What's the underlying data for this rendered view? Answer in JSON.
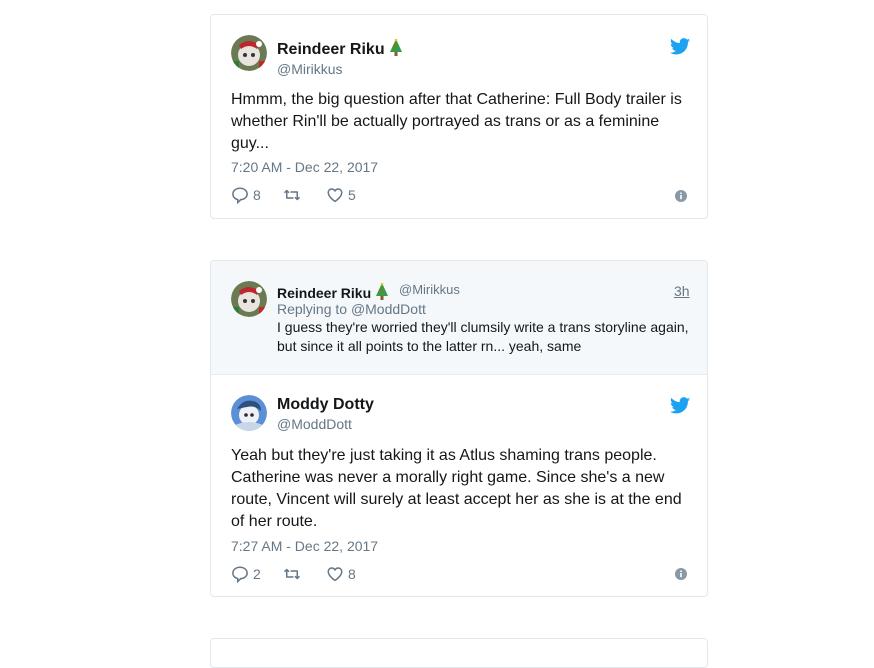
{
  "tweet1": {
    "name": "Reindeer Riku",
    "handle": "@Mirikkus",
    "text": "Hmmm, the big question after that Catherine: Full Body trailer is whether Rin'll be actually portrayed as trans or as a feminine guy...",
    "timestamp": "7:20 AM - Dec 22, 2017",
    "replies": "8",
    "retweets": "",
    "likes": "5"
  },
  "tweet2": {
    "parent": {
      "name": "Reindeer Riku",
      "handle": "@Mirikkus",
      "ago": "3h",
      "replying_prefix": "Replying to",
      "replying_to": "@ModdDott",
      "text": "I guess they're worried they'll clumsily write a trans storyline again, but since it all points to the latter rn... yeah, same"
    },
    "name": "Moddy Dotty",
    "handle": "@ModdDott",
    "text": "Yeah but they're just taking it as Atlus shaming trans people. Catherine was never a morally right game. Since she's a new route, Vincent will surely at least accept her as she is at the end of her route.",
    "timestamp": "7:27 AM - Dec 22, 2017",
    "replies": "2",
    "retweets": "",
    "likes": "8"
  },
  "colors": {
    "twitter_blue": "#1da1f2",
    "muted": "#657786",
    "border": "#e1e8ed",
    "parent_bg": "#f5f8fa"
  }
}
